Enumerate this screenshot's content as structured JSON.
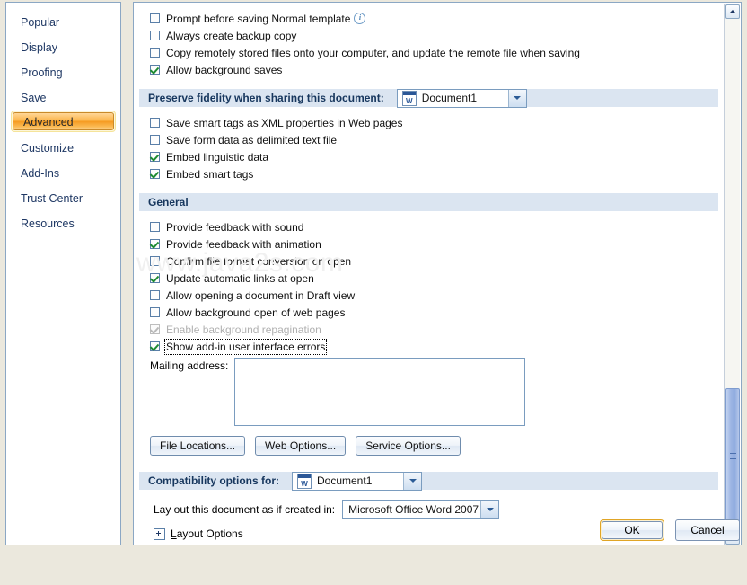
{
  "sidebar": {
    "items": [
      {
        "label": "Popular",
        "selected": false
      },
      {
        "label": "Display",
        "selected": false
      },
      {
        "label": "Proofing",
        "selected": false
      },
      {
        "label": "Save",
        "selected": false
      },
      {
        "label": "Advanced",
        "selected": true
      },
      {
        "label": "Customize",
        "selected": false
      },
      {
        "label": "Add-Ins",
        "selected": false
      },
      {
        "label": "Trust Center",
        "selected": false
      },
      {
        "label": "Resources",
        "selected": false
      }
    ]
  },
  "save_options": {
    "checkboxes": [
      {
        "label": "Prompt before saving Normal template",
        "checked": false,
        "disabled": false,
        "focused": false,
        "info_icon": true
      },
      {
        "label": "Always create backup copy",
        "checked": false,
        "disabled": false,
        "focused": false,
        "info_icon": false
      },
      {
        "label": "Copy remotely stored files onto your computer, and update the remote file when saving",
        "checked": false,
        "disabled": false,
        "focused": false,
        "info_icon": false
      },
      {
        "label": "Allow background saves",
        "checked": true,
        "disabled": false,
        "focused": false,
        "info_icon": false
      }
    ]
  },
  "preserve_fidelity": {
    "band_title": "Preserve fidelity when sharing this document:",
    "document_value": "Document1",
    "document_icon": "word-document-icon",
    "checkboxes": [
      {
        "label": "Save smart tags as XML properties in Web pages",
        "checked": false,
        "disabled": false,
        "focused": false,
        "info_icon": false
      },
      {
        "label": "Save form data as delimited text file",
        "checked": false,
        "disabled": false,
        "focused": false,
        "info_icon": false
      },
      {
        "label": "Embed linguistic data",
        "checked": true,
        "disabled": false,
        "focused": false,
        "info_icon": false
      },
      {
        "label": "Embed smart tags",
        "checked": true,
        "disabled": false,
        "focused": false,
        "info_icon": false
      }
    ]
  },
  "general": {
    "band_title": "General",
    "checkboxes": [
      {
        "label": "Provide feedback with sound",
        "checked": false,
        "disabled": false,
        "focused": false,
        "info_icon": false
      },
      {
        "label": "Provide feedback with animation",
        "checked": true,
        "disabled": false,
        "focused": false,
        "info_icon": false
      },
      {
        "label": "Confirm file format conversion on open",
        "checked": false,
        "disabled": false,
        "focused": false,
        "info_icon": false
      },
      {
        "label": "Update automatic links at open",
        "checked": true,
        "disabled": false,
        "focused": false,
        "info_icon": false
      },
      {
        "label": "Allow opening a document in Draft view",
        "checked": false,
        "disabled": false,
        "focused": false,
        "info_icon": false
      },
      {
        "label": "Allow background open of web pages",
        "checked": false,
        "disabled": false,
        "focused": false,
        "info_icon": false
      },
      {
        "label": "Enable background repagination",
        "checked": true,
        "disabled": true,
        "focused": false,
        "info_icon": false
      },
      {
        "label": "Show add-in user interface errors",
        "checked": true,
        "disabled": false,
        "focused": true,
        "info_icon": false
      }
    ],
    "mailing_address_label": "Mailing address:",
    "mailing_address_value": "",
    "buttons": [
      {
        "label": "File Locations..."
      },
      {
        "label": "Web Options..."
      },
      {
        "label": "Service Options..."
      }
    ]
  },
  "compatibility": {
    "band_title": "Compatibility options for:",
    "document_value": "Document1",
    "document_icon": "word-document-icon",
    "layout_label": "Lay out this document as if created in:",
    "layout_value": "Microsoft Office Word 2007",
    "layout_options_label": "Layout Options"
  },
  "footer": {
    "ok_label": "OK",
    "cancel_label": "Cancel"
  },
  "watermark": {
    "text": "www.java2s.com"
  },
  "colors": {
    "dialog_background": "#ebe8dd",
    "panel_background": "#ffffff",
    "panel_border": "#8ba7c4",
    "band_background": "#dbe5f1",
    "band_text": "#17375e",
    "nav_text": "#1f3864",
    "selected_accent": "#f59a20",
    "checkmark": "#1e8b33",
    "default_button_glow": "#e0a526",
    "scrollbar_thumb": "#9db6e4"
  }
}
